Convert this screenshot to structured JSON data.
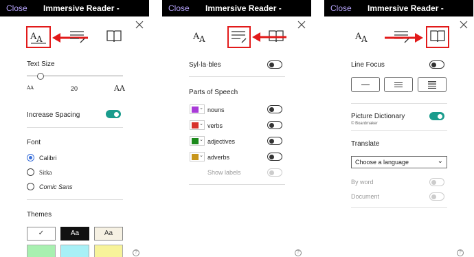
{
  "app": {
    "close_label": "Close",
    "title": "Immersive Reader -"
  },
  "icons": [
    "text-preferences-icon",
    "grammar-options-icon",
    "reading-preferences-icon",
    "close-icon",
    "help-icon"
  ],
  "accent_color": "#1a9c8d",
  "highlight_color": "#e21a1a",
  "panel1": {
    "text_size_label": "Text Size",
    "text_size_min": "AA",
    "text_size_value": "20",
    "text_size_max": "AA",
    "increase_spacing_label": "Increase Spacing",
    "increase_spacing_on": true,
    "font_label": "Font",
    "fonts": [
      "Calibri",
      "Sitka",
      "Comic Sans"
    ],
    "font_selected": "Calibri",
    "themes_label": "Themes",
    "themes": [
      {
        "label": "✓",
        "bg": "#ffffff",
        "fg": "#333333"
      },
      {
        "label": "Aa",
        "bg": "#111111",
        "fg": "#ffffff"
      },
      {
        "label": "Aa",
        "bg": "#f6f1e3",
        "fg": "#333333"
      }
    ],
    "theme_colors_row2": [
      "#a8f0b0",
      "#a8f0f6",
      "#f7f39a"
    ]
  },
  "panel2": {
    "syllables_label": "Syl·la·bles",
    "syllables_on": false,
    "parts_label": "Parts of Speech",
    "parts": [
      {
        "label": "nouns",
        "color": "#a93bd8",
        "on": false
      },
      {
        "label": "verbs",
        "color": "#d7322c",
        "on": false
      },
      {
        "label": "adjectives",
        "color": "#1c8a1c",
        "on": false
      },
      {
        "label": "adverbs",
        "color": "#c8961a",
        "on": false
      }
    ],
    "show_labels_label": "Show labels",
    "show_labels_on": false
  },
  "panel3": {
    "line_focus_label": "Line Focus",
    "line_focus_on": false,
    "picture_dictionary_label": "Picture Dictionary",
    "picture_dictionary_sub": "© Boardmaker",
    "picture_dictionary_on": true,
    "translate_label": "Translate",
    "language_placeholder": "Choose a language",
    "by_word_label": "By word",
    "document_label": "Document"
  },
  "help_label": "?"
}
